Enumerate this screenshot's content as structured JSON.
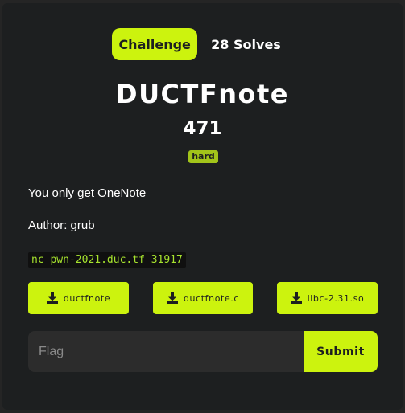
{
  "tabs": {
    "challenge_label": "Challenge",
    "solves_label": "28 Solves"
  },
  "challenge": {
    "name": "DUCTFnote",
    "points": "471",
    "difficulty": "hard",
    "description": "You only get OneNote",
    "author": "Author: grub",
    "connection": "nc pwn-2021.duc.tf 31917"
  },
  "files": [
    {
      "name": "ductfnote",
      "icon": "download-icon"
    },
    {
      "name": "ductfnote.c",
      "icon": "download-icon"
    },
    {
      "name": "libc-2.31.so",
      "icon": "download-icon"
    }
  ],
  "flag_form": {
    "placeholder": "Flag",
    "value": "",
    "submit_label": "Submit"
  },
  "colors": {
    "accent": "#ccf30e",
    "badge": "#a2c41a",
    "background": "#1d1f20",
    "code_text": "#a6e22e"
  }
}
